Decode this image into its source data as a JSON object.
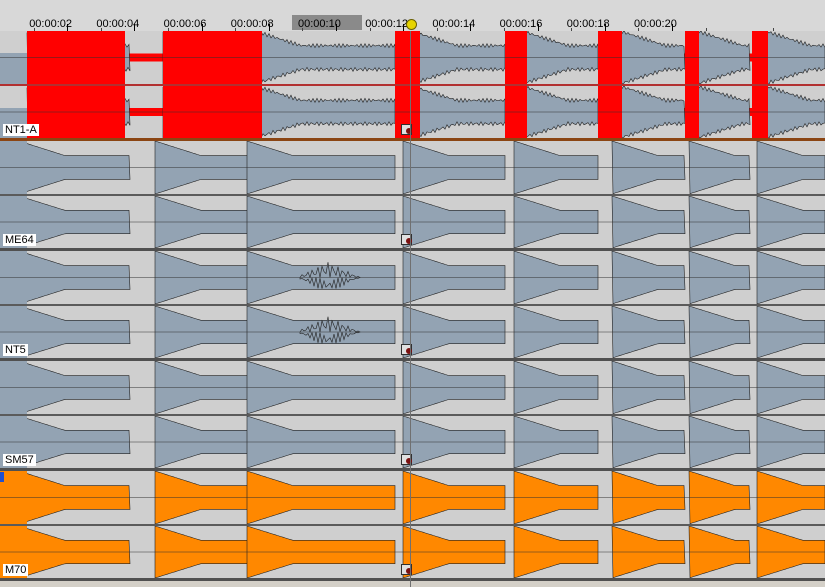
{
  "ruler": {
    "ticks": [
      "00:00:02",
      "00:00:04",
      "00:00:06",
      "00:00:08",
      "00:00:10",
      "00:00:12",
      "00:00:14",
      "00:00:16",
      "00:00:18",
      "00:00:20"
    ],
    "duration_seconds": 24.6
  },
  "tracks": [
    {
      "name": "NT1-A",
      "color": "#ff0000"
    },
    {
      "name": "ME64",
      "color": "#93a3b3"
    },
    {
      "name": "NT5",
      "color": "#93a3b3"
    },
    {
      "name": "SM57",
      "color": "#93a3b3"
    },
    {
      "name": "M70",
      "color": "#ff8800"
    }
  ],
  "colors": {
    "background_waveform": "#cfcfcf",
    "gray_waveform": "#93a3b3",
    "red_waveform": "#ff0000",
    "orange_waveform": "#ff8800"
  },
  "playhead": {
    "time": "00:00:12"
  }
}
